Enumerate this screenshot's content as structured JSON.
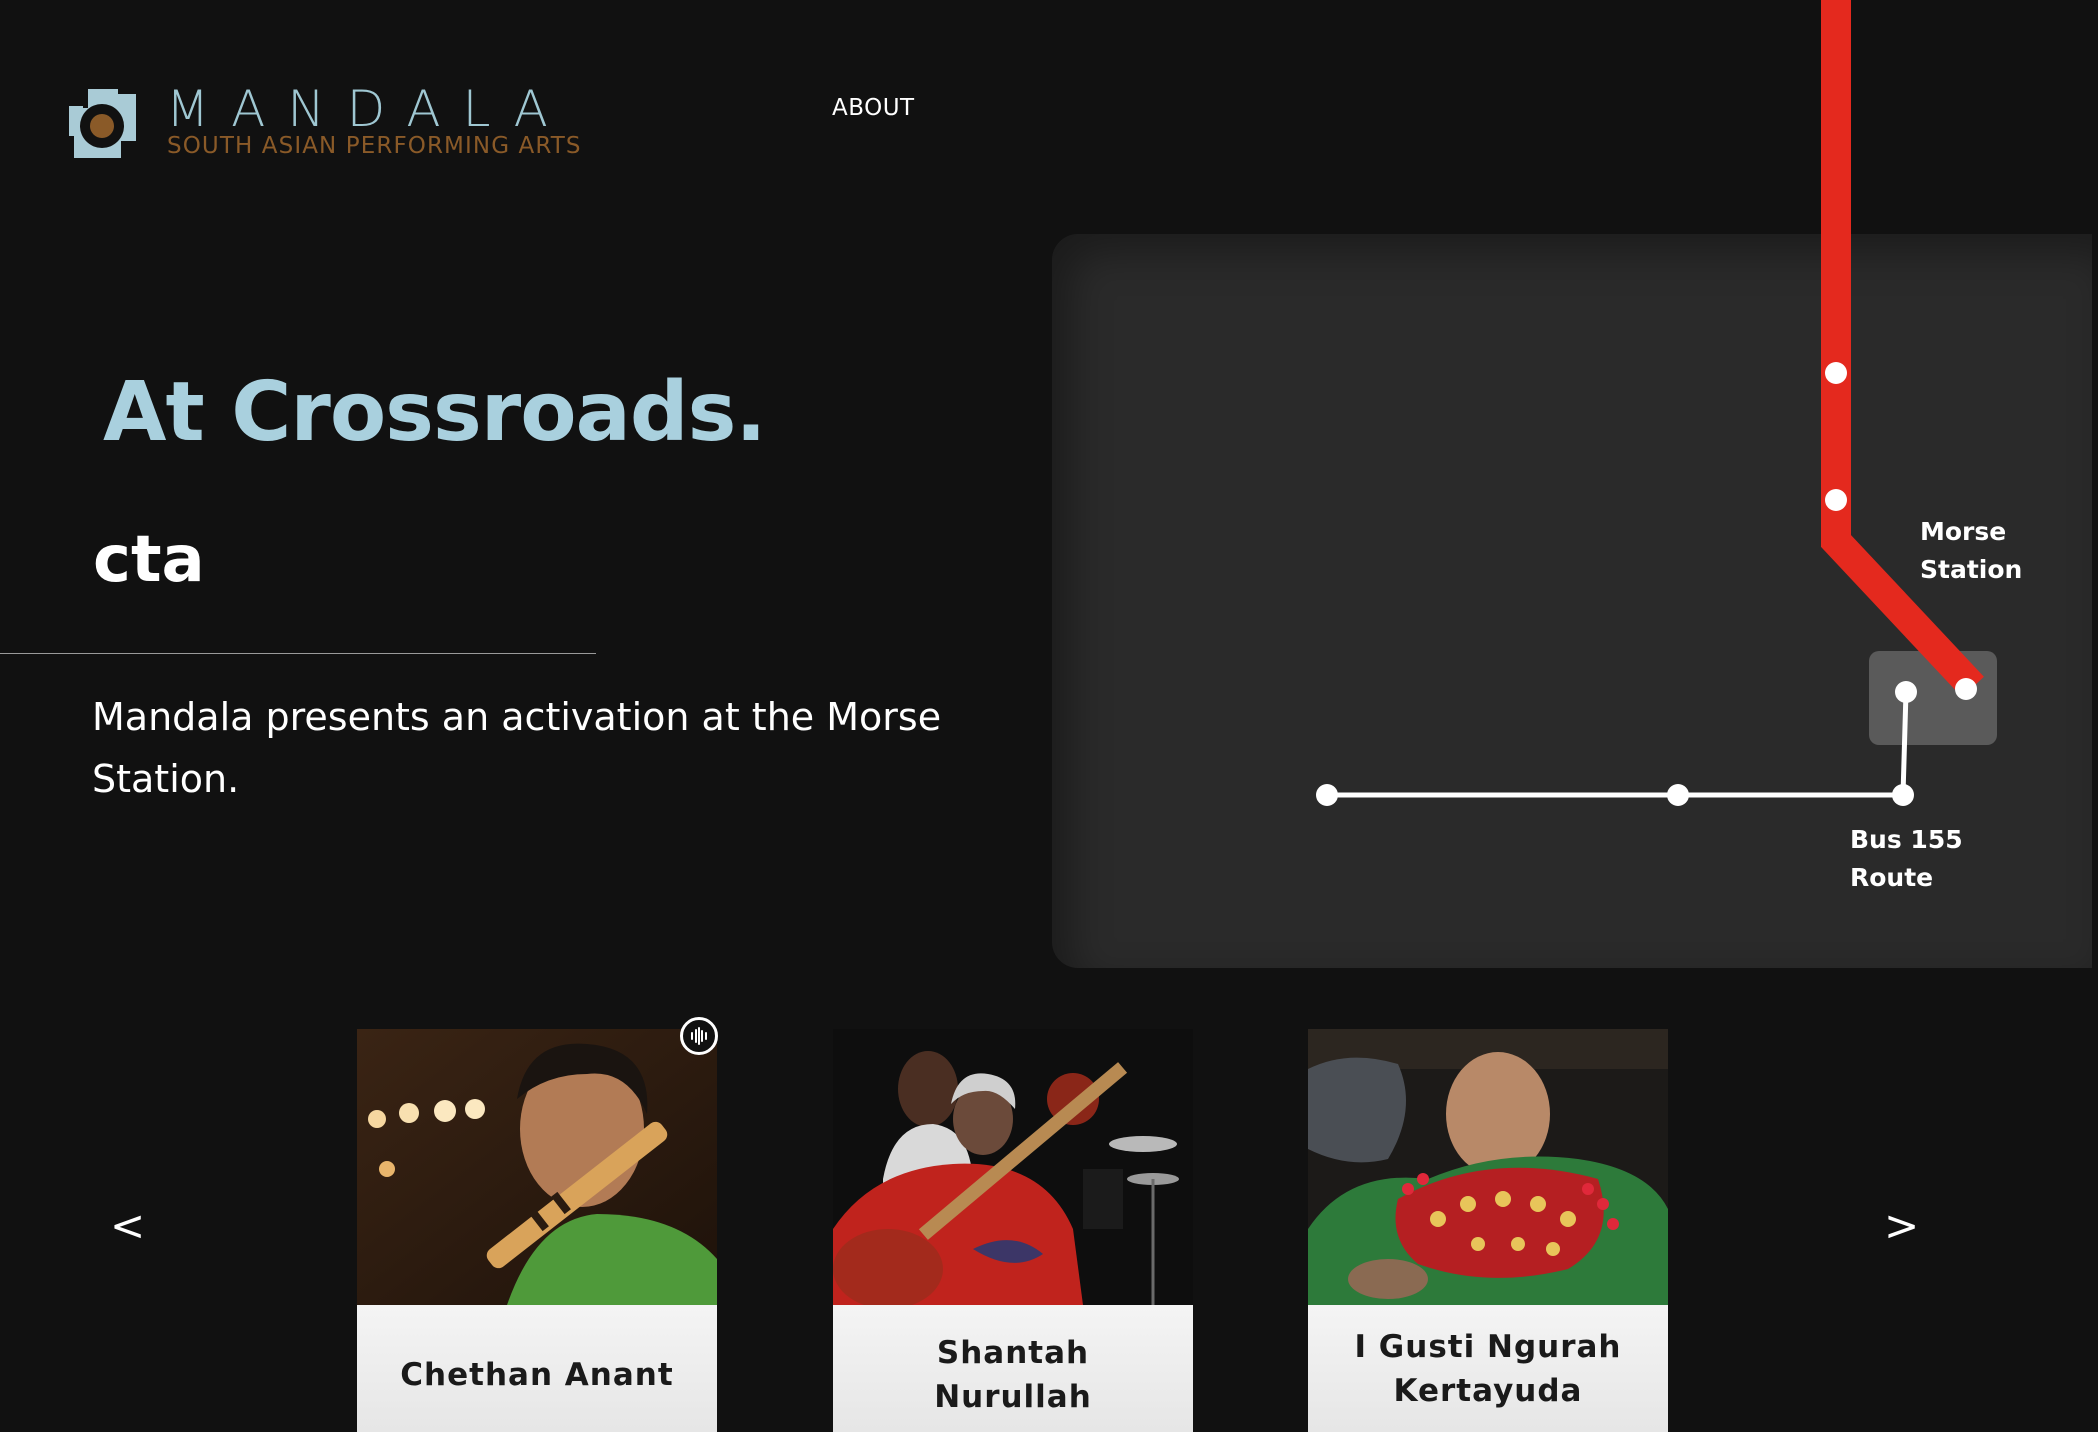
{
  "header": {
    "logo": {
      "name": "MANDALA",
      "tagline": "SOUTH ASIAN PERFORMING ARTS",
      "icon": "mandala-logo-mark"
    },
    "nav": [
      {
        "label": "ABOUT"
      }
    ]
  },
  "hero": {
    "title": "At Crossroads.",
    "subtitle": "cta",
    "description": "Mandala presents an activation at the Morse Station."
  },
  "map": {
    "labels": {
      "morse": "Morse\nStation",
      "bus": "Bus 155\nRoute"
    },
    "colors": {
      "rail_line": "#e4291e",
      "bus_line": "#ffffff",
      "panel": "#2a2a2a",
      "station_box": "#5a5a5a"
    }
  },
  "carousel": {
    "prev_label": "<",
    "next_label": ">",
    "audio_icon": "audio-wave-icon",
    "cards": [
      {
        "name": "Chethan Anant"
      },
      {
        "name": "Shantah Nurullah"
      },
      {
        "name": "I Gusti Ngurah Kertayuda"
      }
    ]
  },
  "colors": {
    "background": "#111111",
    "title_accent": "#a9d0de",
    "logo_blue": "#9fc7d2",
    "logo_brown": "#8a5a28"
  }
}
